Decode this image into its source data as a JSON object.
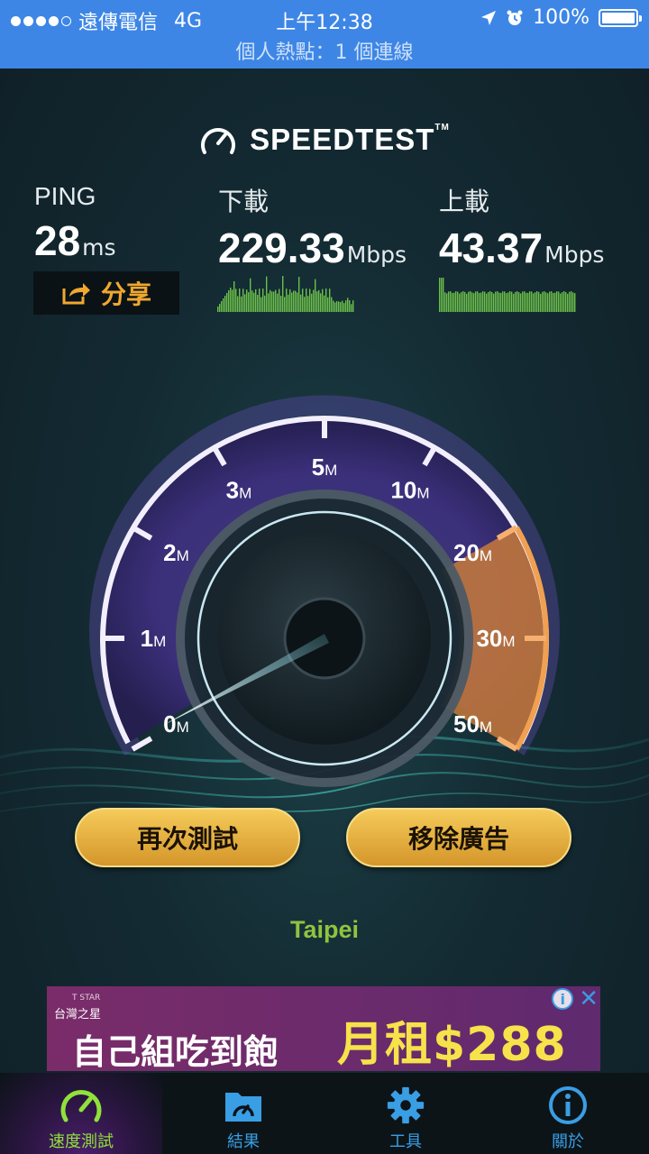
{
  "status_bar": {
    "carrier": "遠傳電信",
    "network": "4G",
    "time": "上午12:38",
    "battery": "100%",
    "battery_level": 1.0,
    "hotspot": "個人熱點：1 個連線"
  },
  "logo": {
    "text": "SPEEDTEST",
    "tm": "TM"
  },
  "stats": {
    "ping": {
      "label": "PING",
      "value": "28",
      "unit": "ms"
    },
    "download": {
      "label": "下載",
      "value": "229.33",
      "unit": "Mbps"
    },
    "upload": {
      "label": "上載",
      "value": "43.37",
      "unit": "Mbps"
    }
  },
  "share_label": "分享",
  "gauge": {
    "ticks": [
      {
        "num": "0",
        "unit": "M"
      },
      {
        "num": "1",
        "unit": "M"
      },
      {
        "num": "2",
        "unit": "M"
      },
      {
        "num": "3",
        "unit": "M"
      },
      {
        "num": "5",
        "unit": "M"
      },
      {
        "num": "10",
        "unit": "M"
      },
      {
        "num": "20",
        "unit": "M"
      },
      {
        "num": "30",
        "unit": "M"
      },
      {
        "num": "50",
        "unit": "M"
      }
    ]
  },
  "buttons": {
    "retest": "再次測試",
    "remove_ads": "移除廣告"
  },
  "location": "Taipei",
  "ad": {
    "brand_small": "T STAR",
    "brand": "台灣之星",
    "main": "自己組吃到飽",
    "price": "月租$288",
    "info_icon": "i",
    "close_icon": "✕"
  },
  "tabs": [
    {
      "label": "速度測試",
      "icon": "speedometer-icon",
      "active": true
    },
    {
      "label": "結果",
      "icon": "folder-icon",
      "active": false
    },
    {
      "label": "工具",
      "icon": "gear-icon",
      "active": false
    },
    {
      "label": "關於",
      "icon": "info-icon",
      "active": false
    }
  ]
}
